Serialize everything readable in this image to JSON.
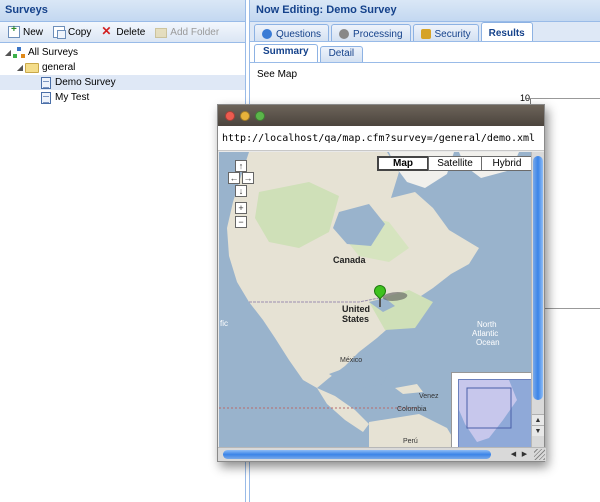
{
  "left_panel": {
    "title": "Surveys",
    "toolbar": {
      "new_label": "New",
      "copy_label": "Copy",
      "delete_label": "Delete",
      "add_folder_label": "Add Folder"
    },
    "tree": {
      "root": "All Surveys",
      "folder": "general",
      "items": [
        "Demo Survey",
        "My Test"
      ],
      "selected": "Demo Survey"
    }
  },
  "editor": {
    "title": "Now Editing: Demo Survey",
    "tabs": [
      {
        "label": "Questions",
        "icon": "help-icon"
      },
      {
        "label": "Processing",
        "icon": "gears-icon"
      },
      {
        "label": "Security",
        "icon": "security-icon"
      },
      {
        "label": "Results",
        "icon": ""
      }
    ],
    "active_tab": "Results",
    "subtabs": [
      "Summary",
      "Detail"
    ],
    "active_subtab": "Summary",
    "see_map_label": "See Map",
    "chart_tick_top": "10"
  },
  "popup": {
    "url": "http://localhost/qa/map.cfm?survey=/general/demo.xml",
    "map_types": [
      "Map",
      "Satellite",
      "Hybrid"
    ],
    "active_map_type": "Map",
    "nav_controls": {
      "up": "↑",
      "left": "←",
      "right": "→",
      "down": "↓",
      "zoom_in": "+",
      "zoom_out": "−"
    },
    "labels": {
      "canada": "Canada",
      "united_states_line1": "United",
      "united_states_line2": "States",
      "north_atlantic_line1": "North",
      "north_atlantic_line2": "Atlantic",
      "north_atlantic_line3": "Ocean",
      "mexico": "México",
      "venezuela": "Venez",
      "colombia": "Colombia",
      "peru": "Perú",
      "pacific_fragment": "fic"
    },
    "colors": {
      "water": "#99b3cc",
      "land": "#e8e4d8",
      "pin": "#3fc21e"
    }
  }
}
